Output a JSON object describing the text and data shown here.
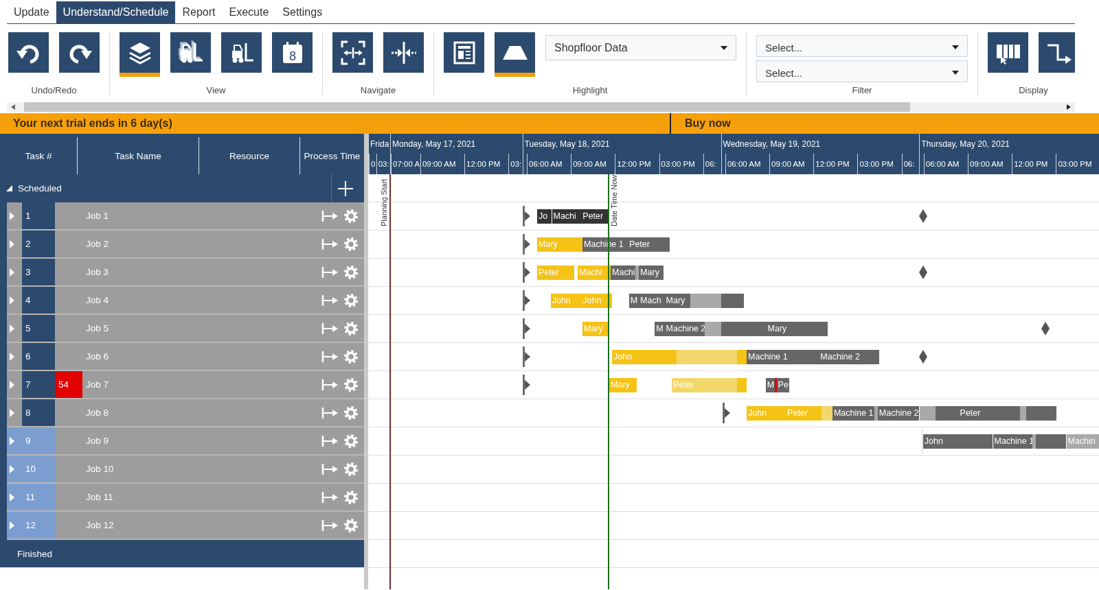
{
  "tabs": [
    {
      "label": "Update",
      "selected": false
    },
    {
      "label": "Understand/Schedule",
      "selected": true
    },
    {
      "label": "Report",
      "selected": false
    },
    {
      "label": "Execute",
      "selected": false
    },
    {
      "label": "Settings",
      "selected": false
    }
  ],
  "toolbar": {
    "groups": [
      {
        "label": "Undo/Redo",
        "items": [
          {
            "kind": "button",
            "selected": false
          },
          {
            "kind": "button",
            "selected": false
          }
        ]
      },
      {
        "label": "View",
        "items": [
          {
            "kind": "button",
            "selected": true
          },
          {
            "kind": "button",
            "selected": false
          },
          {
            "kind": "button",
            "selected": false
          },
          {
            "kind": "button",
            "text": "8",
            "selected": false
          }
        ]
      },
      {
        "label": "Navigate",
        "items": [
          {
            "kind": "button",
            "selected": false
          },
          {
            "kind": "button",
            "selected": false
          }
        ]
      },
      {
        "label": "Highlight",
        "items": [
          {
            "kind": "button",
            "selected": false
          },
          {
            "kind": "button",
            "selected": true
          },
          {
            "kind": "dropdown",
            "value": "Shopfloor Data"
          }
        ]
      },
      {
        "label": "Filter",
        "items": [
          {
            "kind": "dropdown-stack",
            "fields": [
              {
                "value": "Select..."
              },
              {
                "value": "Select..."
              }
            ]
          }
        ]
      },
      {
        "label": "Display",
        "items": [
          {
            "kind": "button",
            "selected": false
          },
          {
            "kind": "button",
            "selected": false
          }
        ]
      }
    ]
  },
  "banner": {
    "message": "Your next trial ends in 6 day(s)",
    "action": "Buy now"
  },
  "table": {
    "columns": [
      "Task #",
      "Task Name",
      "Resource",
      "Process Time"
    ],
    "scheduled": {
      "label": "Scheduled",
      "expanded": true
    },
    "rows": [
      {
        "number": "1",
        "name": "Job 1",
        "highlighted": false,
        "expanded": false
      },
      {
        "number": "2",
        "name": "Job 2",
        "highlighted": false,
        "expanded": false
      },
      {
        "number": "3",
        "name": "Job 3",
        "highlighted": false,
        "expanded": false
      },
      {
        "number": "4",
        "name": "Job 4",
        "highlighted": false,
        "expanded": false
      },
      {
        "number": "5",
        "name": "Job 5",
        "highlighted": false,
        "expanded": false
      },
      {
        "number": "6",
        "name": "Job 6",
        "highlighted": false,
        "expanded": false
      },
      {
        "number": "7",
        "badge": "54",
        "name": "Job 7",
        "highlighted": false,
        "expanded": false
      },
      {
        "number": "8",
        "name": "Job 8",
        "highlighted": false,
        "expanded": false
      },
      {
        "number": "9",
        "name": "Job 9",
        "highlighted": true,
        "expanded": false
      },
      {
        "number": "10",
        "name": "Job 10",
        "highlighted": true,
        "expanded": false
      },
      {
        "number": "11",
        "name": "Job 11",
        "highlighted": true,
        "expanded": false
      },
      {
        "number": "12",
        "name": "Job 12",
        "highlighted": true,
        "expanded": false
      }
    ],
    "finished": {
      "label": "Finished"
    }
  },
  "gantt": {
    "days": [
      {
        "label": "Frida",
        "ticks": [
          "0",
          "03:"
        ]
      },
      {
        "label": "Monday, May 17, 2021",
        "ticks": [
          "07:00 A",
          "09:00 AM",
          "12:00 PM",
          "03:"
        ]
      },
      {
        "label": "Tuesday, May 18, 2021",
        "ticks": [
          "06:00 AM",
          "09:00 AM",
          "12:00 PM",
          "03:00 PM",
          "06:"
        ]
      },
      {
        "label": "Wednesday, May 19, 2021",
        "ticks": [
          "06:00 AM",
          "09:00 AM",
          "12:00 PM",
          "03:00 PM",
          "06:"
        ]
      },
      {
        "label": "Thursday, May 20, 2021",
        "ticks": [
          "06:00 AM",
          "09:00 AM",
          "12:00 PM",
          "03:00 PM"
        ]
      }
    ],
    "lines": [
      {
        "label": "Planning Start",
        "color": "#7b2b2b"
      },
      {
        "label": "Date Time Now",
        "color": "#1e6e1e"
      }
    ],
    "rows": [
      {
        "marker": {
          "kind": "flag"
        },
        "milestone": true,
        "segments": [
          {
            "color": "#333333",
            "label": "Jo"
          },
          {
            "color": "#333333",
            "label": "Machi"
          },
          {
            "color": "#333333",
            "label": "Peter"
          }
        ]
      },
      {
        "marker": {
          "kind": "flag"
        },
        "milestone": false,
        "segments": [
          {
            "color": "#f5c216",
            "label": "Mary"
          },
          {
            "color": "#666666",
            "label": "Machine 1"
          },
          {
            "color": "#666666",
            "label": "Peter"
          }
        ]
      },
      {
        "marker": {
          "kind": "flag"
        },
        "milestone": true,
        "segments": [
          {
            "color": "#f5c216",
            "label": "Peter"
          },
          {
            "color": "#f5c216",
            "label": "Machi"
          },
          {
            "color": "#666666",
            "label": "Machi"
          },
          {
            "color": "#a9a9a9"
          },
          {
            "color": "#666666",
            "label": "Mary"
          }
        ]
      },
      {
        "marker": {
          "kind": "flag"
        },
        "milestone": false,
        "segments": [
          {
            "color": "#f5c216",
            "label": "John"
          },
          {
            "color": "#f5c216",
            "label": "John"
          },
          {
            "color": "#666666",
            "label": "M"
          },
          {
            "color": "#666666",
            "label": "Mach"
          },
          {
            "color": "#666666",
            "label": "Mary"
          },
          {
            "color": "#a9a9a9"
          },
          {
            "color": "#666666"
          }
        ]
      },
      {
        "marker": {
          "kind": "flag"
        },
        "milestone": true,
        "segments": [
          {
            "color": "#f5c216",
            "label": "Mary"
          },
          {
            "color": "#666666",
            "label": "M"
          },
          {
            "color": "#666666",
            "label": "Machine 2"
          },
          {
            "color": "#a9a9a9"
          },
          {
            "color": "#666666"
          },
          {
            "color": "#666666",
            "label": "Mary"
          }
        ]
      },
      {
        "marker": {
          "kind": "flag"
        },
        "milestone": true,
        "segments": [
          {
            "color": "#f5c216",
            "label": "John"
          },
          {
            "color": "#f2d76b"
          },
          {
            "color": "#f2d76b"
          },
          {
            "color": "#f5c216"
          },
          {
            "color": "#666666",
            "label": "Machine 1"
          },
          {
            "color": "#666666",
            "label": "Machine 2"
          }
        ]
      },
      {
        "marker": {
          "kind": "flag"
        },
        "milestone": false,
        "segments": [
          {
            "color": "#f5c216",
            "label": "Mary"
          },
          {
            "color": "#f2d76b",
            "label": "Peter"
          },
          {
            "color": "#f2d76b"
          },
          {
            "color": "#f5c216"
          },
          {
            "color": "#666666",
            "label": "M"
          },
          {
            "color": "#e00000"
          },
          {
            "color": "#666666",
            "label": "Pe"
          }
        ]
      },
      {
        "marker": {
          "kind": "flag"
        },
        "milestone": false,
        "segments": [
          {
            "color": "#f5c216",
            "label": "John"
          },
          {
            "color": "#f5c216",
            "label": "Peter"
          },
          {
            "color": "#f2d76b"
          },
          {
            "color": "#666666",
            "label": "Machine 1"
          },
          {
            "color": "#a9a9a9"
          },
          {
            "color": "#666666",
            "label": "Machine 2"
          },
          {
            "color": "#a9a9a9"
          },
          {
            "color": "#666666"
          },
          {
            "color": "#666666",
            "label": "Peter"
          },
          {
            "color": "#a9a9a9"
          },
          {
            "color": "#666666"
          }
        ]
      },
      {
        "marker": {
          "kind": "tick"
        },
        "milestone": false,
        "segments": [
          {
            "color": "#666666",
            "label": "John"
          },
          {
            "color": "#666666",
            "label": "Machine 1"
          },
          {
            "color": "#a9a9a9"
          },
          {
            "color": "#666666"
          },
          {
            "color": "#a9a9a9",
            "label": "Machin"
          }
        ]
      }
    ]
  }
}
